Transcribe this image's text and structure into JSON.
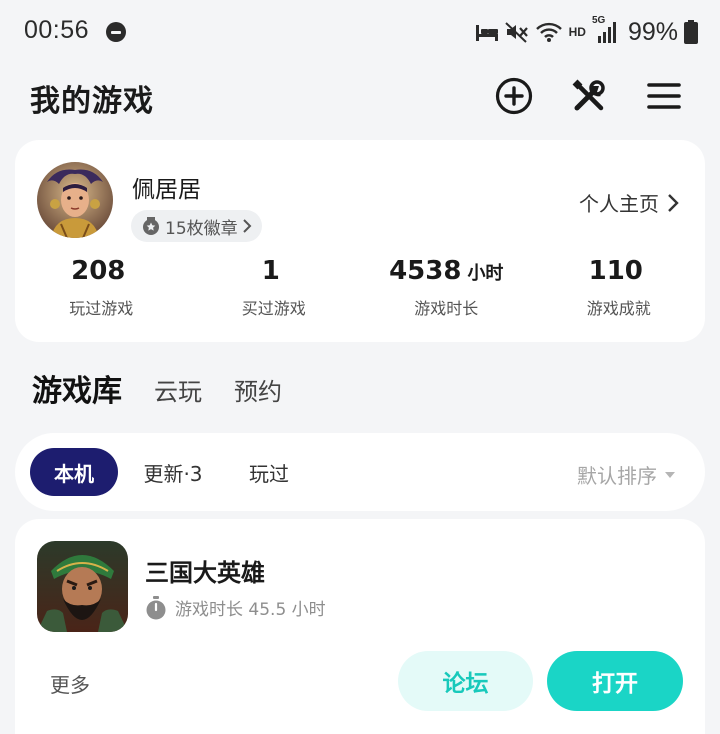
{
  "status_bar": {
    "time": "00:56",
    "hd_label": "HD",
    "network_label": "5G",
    "battery": "99%",
    "icons": [
      "do-not-disturb-icon",
      "sleep-icon",
      "mute-icon",
      "wifi-icon",
      "signal-icon",
      "battery-icon"
    ]
  },
  "header": {
    "title": "我的游戏",
    "icons": [
      "add-circle-icon",
      "tools-icon",
      "menu-icon"
    ]
  },
  "profile": {
    "username": "佩居居",
    "badges": "15枚徽章",
    "homepage_link": "个人主页",
    "stats": [
      {
        "value": "208",
        "unit": "",
        "label": "玩过游戏"
      },
      {
        "value": "1",
        "unit": "",
        "label": "买过游戏"
      },
      {
        "value": "4538",
        "unit": "小时",
        "label": "游戏时长"
      },
      {
        "value": "110",
        "unit": "",
        "label": "游戏成就"
      }
    ]
  },
  "library_tabs": [
    {
      "label": "游戏库",
      "active": true
    },
    {
      "label": "云玩",
      "active": false
    },
    {
      "label": "预约",
      "active": false
    }
  ],
  "filters": {
    "chips": [
      {
        "label": "本机",
        "active": true
      },
      {
        "label": "更新·3",
        "active": false
      },
      {
        "label": "玩过",
        "active": false
      }
    ],
    "sort_label": "默认排序"
  },
  "game": {
    "name": "三国大英雄",
    "playtime": "游戏时长 45.5 小时",
    "more_label": "更多",
    "forum_label": "论坛",
    "open_label": "打开"
  },
  "colors": {
    "accent": "#1ad5c6",
    "accent_light": "#e4faf8",
    "chip_active": "#1d1d6f",
    "background": "#f4f5f7"
  }
}
